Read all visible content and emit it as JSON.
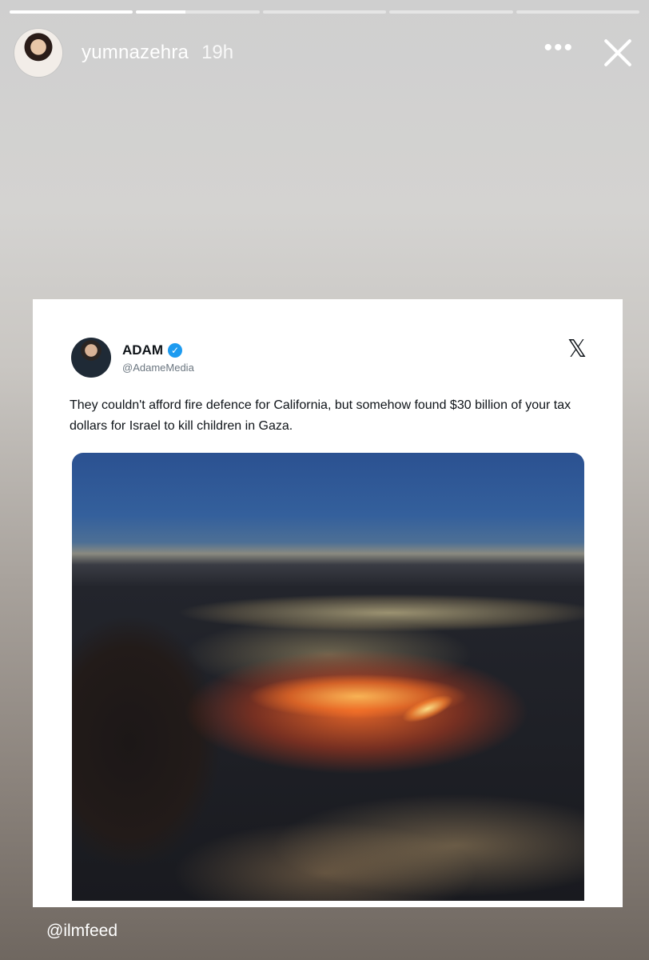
{
  "story": {
    "progress": [
      {
        "fill": 1
      },
      {
        "fill": 0.4
      },
      {
        "fill": 0
      },
      {
        "fill": 0
      },
      {
        "fill": 0
      }
    ],
    "username": "yumnazehra",
    "time": "19h",
    "more_label": "•••",
    "caption": "@ilmfeed"
  },
  "tweet": {
    "name": "ADAM",
    "verified_glyph": "✓",
    "handle": "@AdameMedia",
    "x_logo": "𝕏",
    "text": "They couldn't afford fire defence for California, but somehow found $30 billion of your tax dollars for Israel to kill children in Gaza."
  },
  "colors": {
    "verified": "#1d9bf0",
    "card": "#ffffff"
  },
  "icons": [
    "more-icon",
    "close-icon",
    "verified-icon",
    "x-logo-icon"
  ]
}
